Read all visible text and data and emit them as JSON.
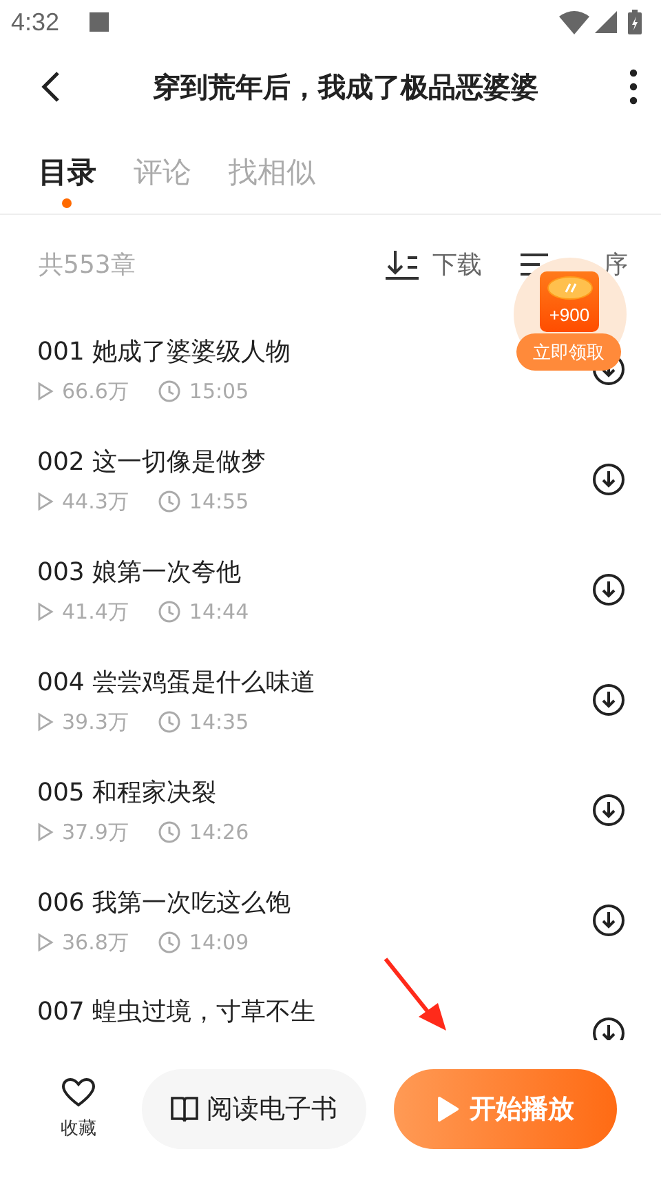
{
  "status_bar": {
    "time": "4:32"
  },
  "header": {
    "title": "穿到荒年后，我成了极品恶婆婆"
  },
  "tabs": [
    {
      "label": "目录",
      "selected": true
    },
    {
      "label": "评论",
      "selected": false
    },
    {
      "label": "找相似",
      "selected": false
    }
  ],
  "toolbar": {
    "chapter_count": "共553章",
    "download": "下载",
    "sort": "序"
  },
  "reward": {
    "amount": "+900",
    "action": "立即领取"
  },
  "chapters": [
    {
      "title": "001 她成了婆婆级人物",
      "plays": "66.6万",
      "duration": "15:05"
    },
    {
      "title": "002 这一切像是做梦",
      "plays": "44.3万",
      "duration": "14:55"
    },
    {
      "title": "003 娘第一次夸他",
      "plays": "41.4万",
      "duration": "14:44"
    },
    {
      "title": "004 尝尝鸡蛋是什么味道",
      "plays": "39.3万",
      "duration": "14:35"
    },
    {
      "title": "005 和程家决裂",
      "plays": "37.9万",
      "duration": "14:26"
    },
    {
      "title": "006 我第一次吃这么饱",
      "plays": "36.8万",
      "duration": "14:09"
    },
    {
      "title": "007 蝗虫过境，寸草不生"
    }
  ],
  "bottom_bar": {
    "favorite": "收藏",
    "read": "阅读电子书",
    "play": "开始播放"
  }
}
